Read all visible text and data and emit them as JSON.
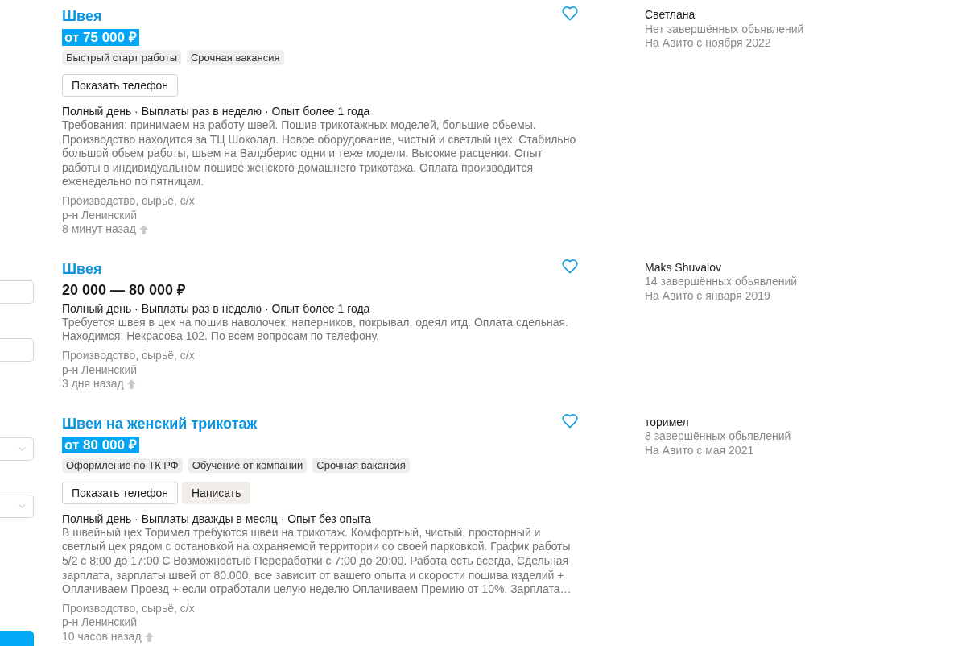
{
  "sidebar": {
    "controls": [
      {
        "kind": "input"
      },
      {
        "kind": "input"
      },
      {
        "kind": "select"
      },
      {
        "kind": "select"
      },
      {
        "kind": "button"
      }
    ]
  },
  "listings": [
    {
      "title": "Швея",
      "favorite": false,
      "price": {
        "text": "от 75 000 ₽",
        "highlighted": true
      },
      "tags": [
        "Быстрый старт работы",
        "Срочная вакансия"
      ],
      "buttons": [
        {
          "label": "Показать телефон",
          "kind": "outline"
        }
      ],
      "conditions": "Полный день · Выплаты раз в неделю · Опыт более 1 года",
      "description": "Требования: принимаем на работу швей. Пошив трикотажных моделей, большие обьемы. Производство находится за ТЦ Шоколад. Новое оборудование, чистый и светлый цех. Стабильно большой обьем работы, шьем на Валдберис одни и теже модели. Высокие расценки. Опыт работы в индивидуальном пошиве женского домашнего трикотажа. Оплата производится еженедельно по пятницам.",
      "category": "Производство, сырьё, с/х",
      "district": "р-н Ленинский",
      "posted": "8 минут назад",
      "seller": {
        "name": "Светлана",
        "completed": "Нет завершённых обьявлений",
        "since": "На Авито с ноября 2022"
      }
    },
    {
      "title": "Швея",
      "favorite": false,
      "price": {
        "text": "20 000 — 80 000 ₽",
        "highlighted": false
      },
      "conditions": "Полный день · Выплаты раз в неделю · Опыт более 1 года",
      "description": "Требуется швея в цех на пошив наволочек, наперников, покрывал, одеял итд. Оплата сдельная. Находимся: Некрасова 102. По всем вопросам по телефону.",
      "category": "Производство, сырьё, с/х",
      "district": "р-н Ленинский",
      "posted": "3 дня назад",
      "seller": {
        "name": "Maks Shuvalov",
        "completed": "14 завершённых обьявлений",
        "since": "На Авито с января 2019"
      }
    },
    {
      "title": "Швеи на женский трикотаж",
      "favorite": false,
      "price": {
        "text": "от 80 000 ₽",
        "highlighted": true
      },
      "tags": [
        "Оформление по ТК РФ",
        "Обучение от компании",
        "Срочная вакансия"
      ],
      "buttons": [
        {
          "label": "Показать телефон",
          "kind": "outline"
        },
        {
          "label": "Написать",
          "kind": "filled"
        }
      ],
      "conditions": "Полный день · Выплаты дважды в месяц · Опыт без опыта",
      "description": "В швейный цех Торимел требуются швеи на трикотаж. Комфортный, чистый, просторный и светлый цех рядом с остановкой на охраняемой территории со своей парковкой. График работы 5/2 с 8:00 до 17:00 С Возможностью Переработки с 7:00 до 20:00. Работа есть всегда, Сдельная зарплата, зарплаты швей от 80.000, все зависит от вашего опыта и скорости пошива изделий + Оплачиваем Проезд + если отработали целую неделю Оплачиваем Премию от 10%. Зарплата…",
      "category": "Производство, сырьё, с/х",
      "district": "р-н Ленинский",
      "posted": "10 часов назад",
      "seller": {
        "name": "торимел",
        "completed": "8 завершённых обьявлений",
        "since": "На Авито с мая 2021"
      }
    }
  ]
}
